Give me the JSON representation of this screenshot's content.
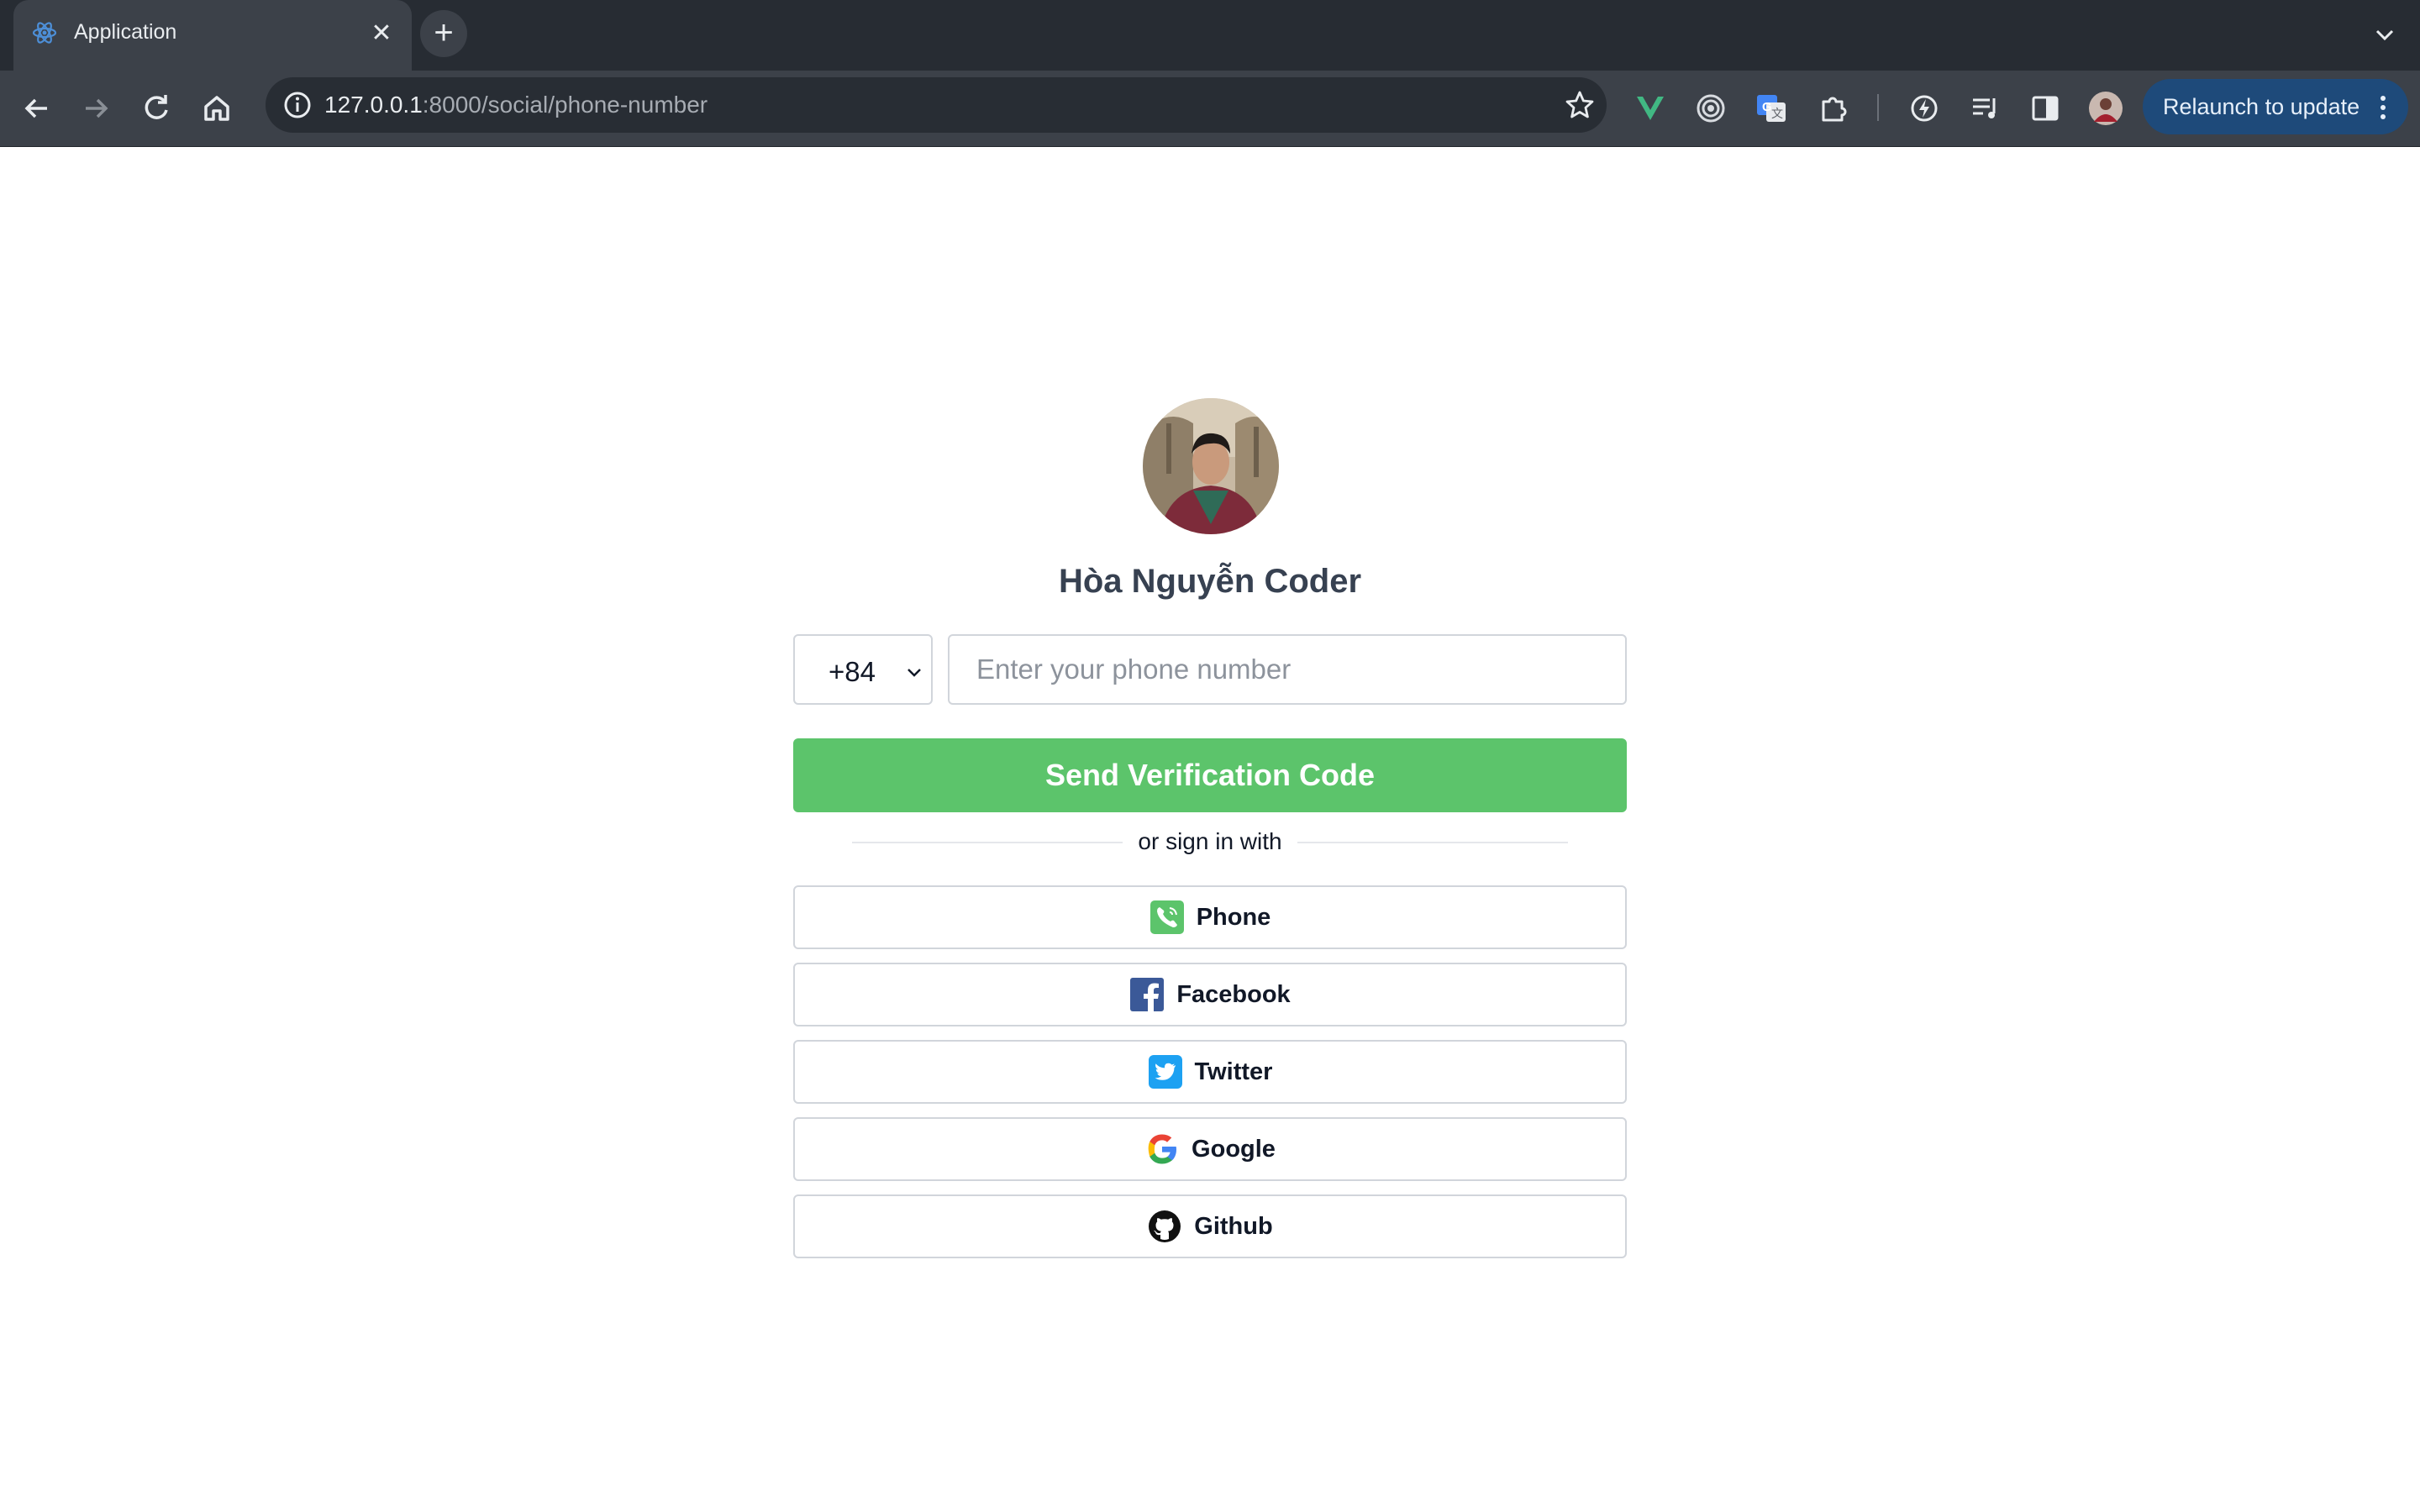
{
  "browser": {
    "tab": {
      "title": "Application",
      "favicon": "app-logo-icon"
    },
    "address_bar": {
      "host": "127.0.0.1",
      "path": ":8000/social/phone-number"
    },
    "relaunch_label": "Relaunch to update",
    "extensions": [
      "vue-devtools-icon",
      "target-icon",
      "google-translate-icon",
      "extensions-puzzle-icon",
      "lightning-icon",
      "reading-list-icon",
      "side-panel-icon",
      "profile-avatar"
    ]
  },
  "profile": {
    "name": "Hòa Nguyễn Coder"
  },
  "phone_form": {
    "country_code": "+84",
    "phone_placeholder": "Enter your phone number",
    "phone_value": "",
    "send_label": "Send Verification Code"
  },
  "divider_text": "or sign in with",
  "social_buttons": [
    {
      "label": "Phone",
      "icon": "phone-icon"
    },
    {
      "label": "Facebook",
      "icon": "facebook-icon"
    },
    {
      "label": "Twitter",
      "icon": "twitter-icon"
    },
    {
      "label": "Google",
      "icon": "google-icon"
    },
    {
      "label": "Github",
      "icon": "github-icon"
    }
  ],
  "colors": {
    "primary_button": "#5cc46b",
    "chrome_dark": "#272c33",
    "chrome_toolbar": "#3c4149",
    "relaunch_button": "#1e4a7a",
    "facebook": "#3b5998",
    "twitter": "#1da1f2",
    "phone": "#5cc46b"
  }
}
